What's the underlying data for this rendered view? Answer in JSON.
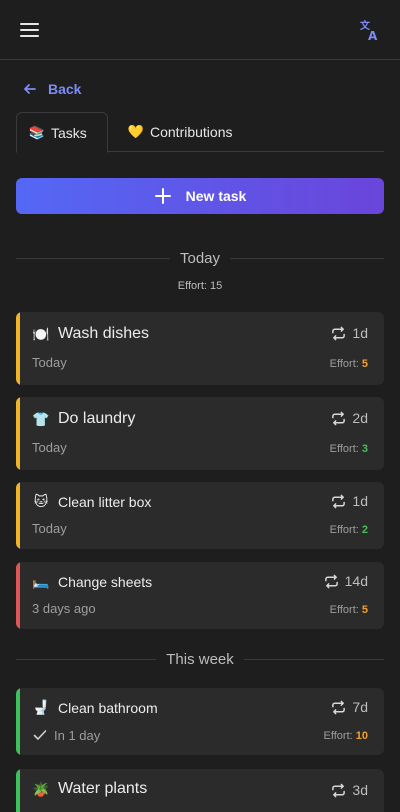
{
  "header": {
    "menu_icon": "hamburger-menu-icon",
    "translate_icon": "translate-icon"
  },
  "nav": {
    "back_label": "Back"
  },
  "tabs": [
    {
      "label": "Tasks",
      "icon": "📚",
      "active": true
    },
    {
      "label": "Contributions",
      "icon": "💛",
      "active": false
    }
  ],
  "new_task": {
    "label": "New task"
  },
  "sections": [
    {
      "label": "Today",
      "effort_label": "Effort: 15",
      "tasks": [
        {
          "emoji": "🍽️",
          "title": "Wash dishes",
          "repeat": "1d",
          "due": "Today",
          "effort_label": "Effort:",
          "effort": "5",
          "status_color": "#f0b429",
          "effort_color": "#f0a030"
        },
        {
          "emoji": "👕",
          "title": "Do laundry",
          "repeat": "2d",
          "due": "Today",
          "effort_label": "Effort:",
          "effort": "3",
          "status_color": "#f0b429",
          "effort_color": "#4cbb5a"
        },
        {
          "emoji": "🐱",
          "title": "Clean litter box",
          "repeat": "1d",
          "due": "Today",
          "effort_label": "Effort:",
          "effort": "2",
          "status_color": "#f0b429",
          "effort_color": "#4cbb5a"
        },
        {
          "emoji": "🛏️",
          "title": "Change sheets",
          "repeat": "14d",
          "due": "3 days ago",
          "effort_label": "Effort:",
          "effort": "5",
          "status_color": "#e05555",
          "effort_color": "#f0a030"
        }
      ]
    },
    {
      "label": "This week",
      "tasks": [
        {
          "emoji": "🚽",
          "title": "Clean bathroom",
          "repeat": "7d",
          "due": "In 1 day",
          "effort_label": "Effort:",
          "effort": "10",
          "status_color": "#3ec15a",
          "effort_color": "#f0a030",
          "done_check": true
        },
        {
          "emoji": "🪴",
          "title": "Water plants",
          "repeat": "3d",
          "status_color": "#3ec15a"
        }
      ]
    }
  ]
}
